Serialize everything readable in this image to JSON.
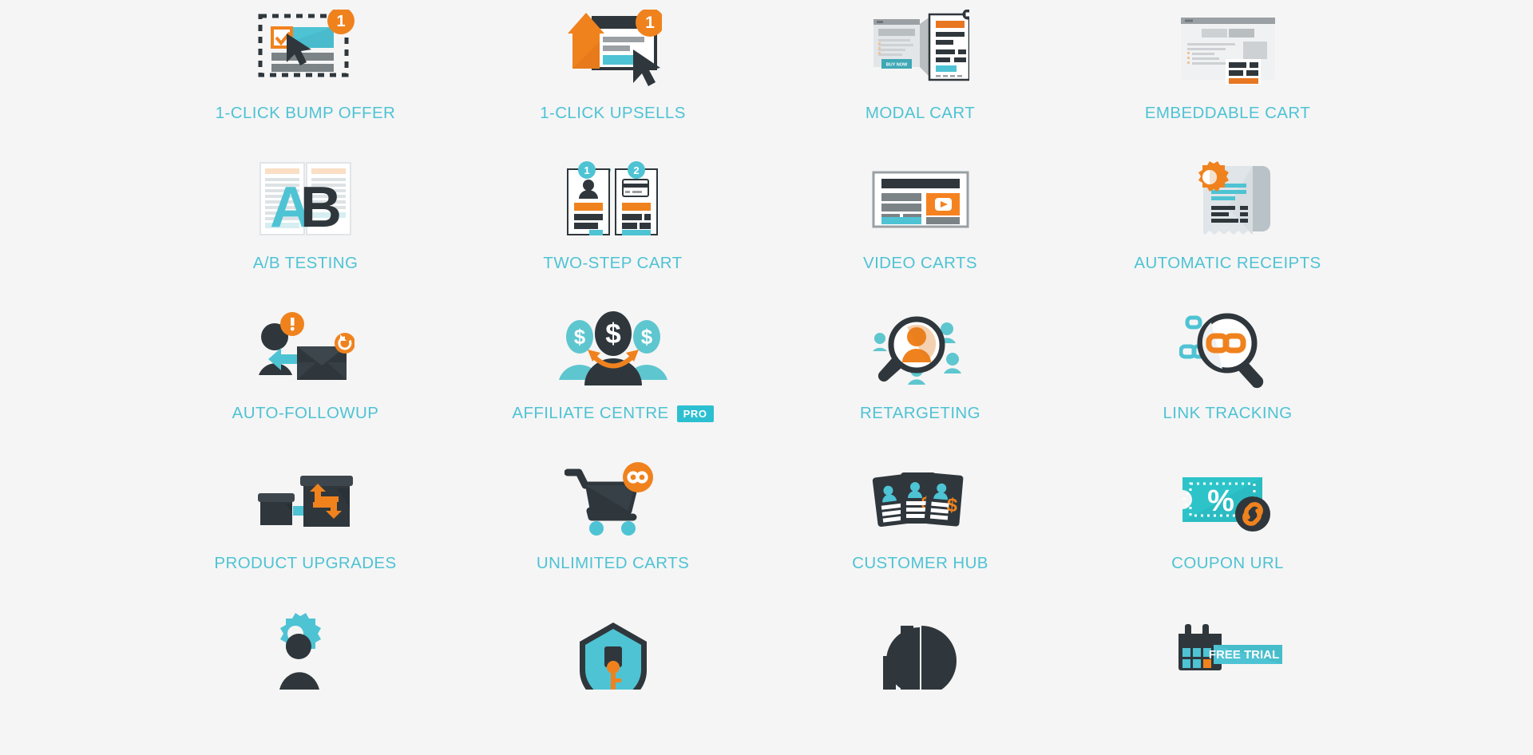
{
  "page": {
    "background_color": "#f5f5f5",
    "label_color": "#4ec3d4",
    "accent_orange": "#f0821e",
    "accent_teal": "#4ec3d4",
    "dark": "#2f373c",
    "badge_color": "#2cbfd1",
    "columns": 4
  },
  "features": [
    {
      "id": "one-click-bump-offer",
      "label": "1-CLICK BUMP OFFER",
      "icon": "bump-offer-icon",
      "badge": null
    },
    {
      "id": "one-click-upsells",
      "label": "1-CLICK UPSELLS",
      "icon": "upsell-arrow-icon",
      "badge": null
    },
    {
      "id": "modal-cart",
      "label": "MODAL CART",
      "icon": "modal-cart-icon",
      "badge": null
    },
    {
      "id": "embeddable-cart",
      "label": "EMBEDDABLE CART",
      "icon": "embeddable-cart-icon",
      "badge": null
    },
    {
      "id": "ab-testing",
      "label": "A/B TESTING",
      "icon": "ab-testing-icon",
      "badge": null
    },
    {
      "id": "two-step-cart",
      "label": "TWO-STEP CART",
      "icon": "two-step-cart-icon",
      "badge": null
    },
    {
      "id": "video-carts",
      "label": "VIDEO CARTS",
      "icon": "video-cart-icon",
      "badge": null
    },
    {
      "id": "automatic-receipts",
      "label": "AUTOMATIC RECEIPTS",
      "icon": "receipt-gear-icon",
      "badge": null
    },
    {
      "id": "auto-followup",
      "label": "AUTO-FOLLOWUP",
      "icon": "followup-envelope-icon",
      "badge": null
    },
    {
      "id": "affiliate-centre",
      "label": "AFFILIATE CENTRE",
      "icon": "affiliate-people-icon",
      "badge": "PRO"
    },
    {
      "id": "retargeting",
      "label": "RETARGETING",
      "icon": "magnifier-person-icon",
      "badge": null
    },
    {
      "id": "link-tracking",
      "label": "LINK TRACKING",
      "icon": "magnifier-link-icon",
      "badge": null
    },
    {
      "id": "product-upgrades",
      "label": "PRODUCT UPGRADES",
      "icon": "boxes-swap-icon",
      "badge": null
    },
    {
      "id": "unlimited-carts",
      "label": "UNLIMITED CARTS",
      "icon": "cart-infinity-icon",
      "badge": null
    },
    {
      "id": "customer-hub",
      "label": "CUSTOMER HUB",
      "icon": "customer-cards-icon",
      "badge": null
    },
    {
      "id": "coupon-url",
      "label": "COUPON URL",
      "icon": "coupon-link-icon",
      "badge": null
    },
    {
      "id": "integrations",
      "label": "",
      "icon": "gear-person-icon",
      "badge": null
    },
    {
      "id": "secure",
      "label": "",
      "icon": "shield-key-icon",
      "badge": null
    },
    {
      "id": "analytics",
      "label": "",
      "icon": "bar-pie-chart-icon",
      "badge": null
    },
    {
      "id": "free-trial",
      "label": "",
      "icon": "free-trial-icon",
      "badge": "FREE TRIAL"
    }
  ],
  "misc": {
    "buy_now_label": "BUY NOW",
    "free_trial_label": "FREE TRIAL"
  }
}
